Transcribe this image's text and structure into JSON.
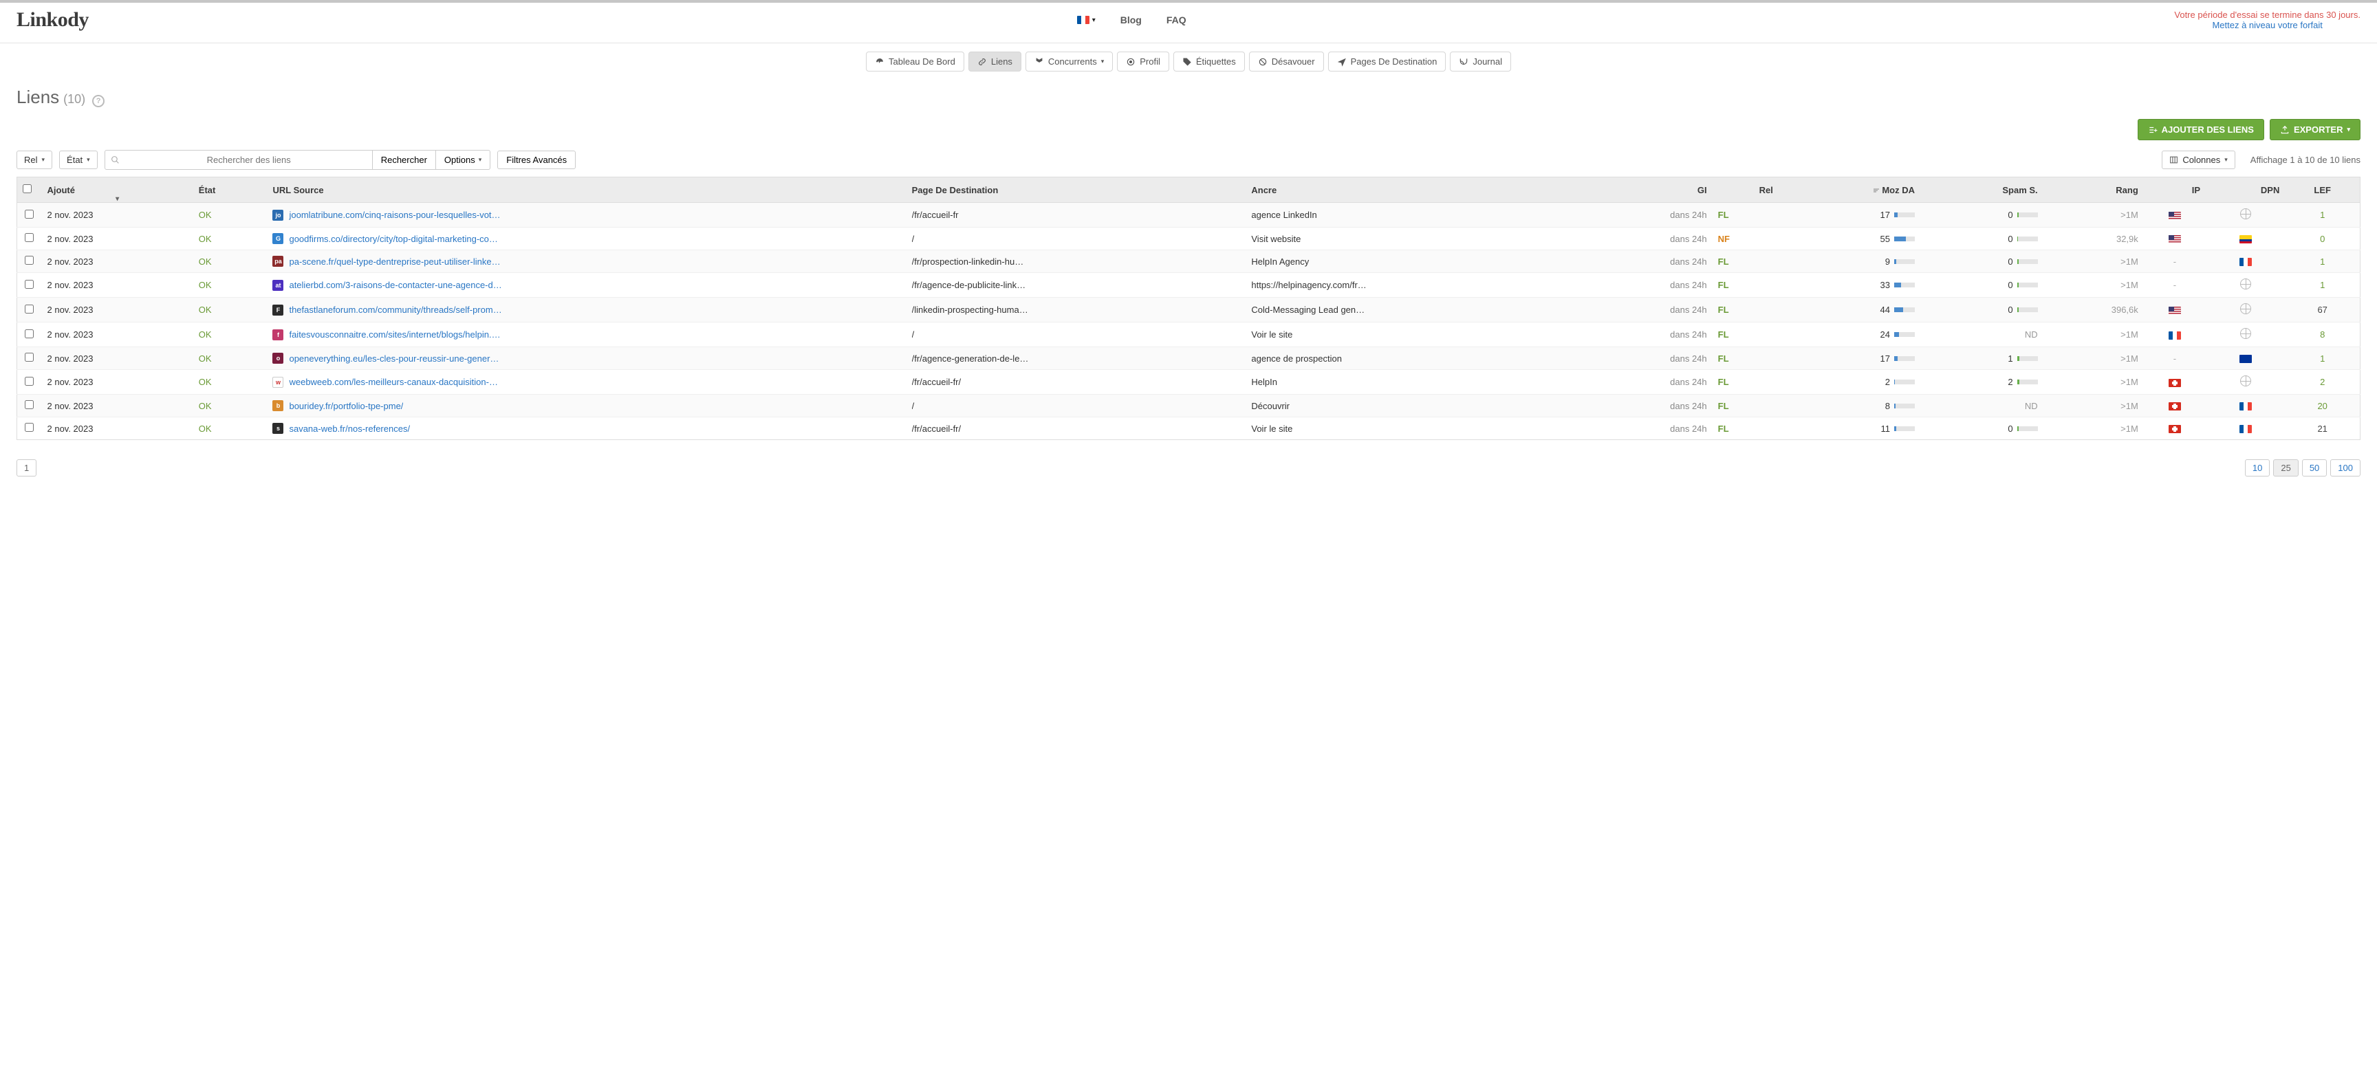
{
  "header": {
    "logo": "Linkody",
    "language_flag": "fr",
    "nav": {
      "blog": "Blog",
      "faq": "FAQ"
    },
    "trial_message": "Votre période d'essai se termine dans 30 jours.",
    "upgrade_link": "Mettez à niveau votre forfait"
  },
  "tabs": {
    "dashboard": "Tableau De Bord",
    "links": "Liens",
    "competitors": "Concurrents",
    "profile": "Profil",
    "tags": "Étiquettes",
    "disavow": "Désavouer",
    "landing_pages": "Pages De Destination",
    "journal": "Journal"
  },
  "page": {
    "title": "Liens",
    "count_label": "(10)"
  },
  "actions": {
    "add_links": "AJOUTER DES LIENS",
    "export": "EXPORTER"
  },
  "toolbar": {
    "rel_dd": "Rel",
    "state_dd": "État",
    "search_placeholder": "Rechercher des liens",
    "search_btn": "Rechercher",
    "options_btn": "Options",
    "adv_filters": "Filtres Avancés",
    "columns_btn": "Colonnes",
    "display_info": "Affichage 1 à 10 de 10 liens"
  },
  "columns": {
    "added": "Ajouté",
    "state": "État",
    "source_url": "URL Source",
    "dest_page": "Page De Destination",
    "anchor": "Ancre",
    "gi": "GI",
    "rel": "Rel",
    "moz_da": "Moz DA",
    "spam": "Spam S.",
    "rank": "Rang",
    "ip": "IP",
    "dpn": "DPN",
    "lef": "LEF"
  },
  "rows": [
    {
      "added": "2 nov. 2023",
      "state": "OK",
      "fav_bg": "#2b6cb0",
      "fav_txt": "jo",
      "src": "joomlatribune.com/cinq-raisons-pour-lesquelles-votre-ent…",
      "dest": "/fr/accueil-fr",
      "anchor": "agence LinkedIn",
      "gi": "dans 24h",
      "rel": "FL",
      "moz_da": 17,
      "da_pct": 17,
      "spam": 0,
      "spam_pct": 8,
      "rank": ">1M",
      "ip": "us",
      "dpn": "globe",
      "lef": "1",
      "lef_color": "g"
    },
    {
      "added": "2 nov. 2023",
      "state": "OK",
      "fav_bg": "#3182ce",
      "fav_txt": "G",
      "src": "goodfirms.co/directory/city/top-digital-marketing-compani…",
      "dest": "/",
      "anchor": "Visit website",
      "gi": "dans 24h",
      "rel": "NF",
      "moz_da": 55,
      "da_pct": 55,
      "spam": 0,
      "spam_pct": 6,
      "rank": "32,9k",
      "ip": "us",
      "dpn": "co",
      "lef": "0",
      "lef_color": "g"
    },
    {
      "added": "2 nov. 2023",
      "state": "OK",
      "fav_bg": "#8b2b2b",
      "fav_txt": "pa",
      "src": "pa-scene.fr/quel-type-dentreprise-peut-utiliser-linkedin-p…",
      "dest": "/fr/prospection-linkedin-hum…",
      "anchor": "HelpIn Agency",
      "gi": "dans 24h",
      "rel": "FL",
      "moz_da": 9,
      "da_pct": 9,
      "spam": 0,
      "spam_pct": 8,
      "rank": ">1M",
      "ip": "dash",
      "dpn": "fr",
      "lef": "1",
      "lef_color": "g"
    },
    {
      "added": "2 nov. 2023",
      "state": "OK",
      "fav_bg": "#4c2fbf",
      "fav_txt": "at",
      "src": "atelierbd.com/3-raisons-de-contacter-une-agence-de-pu…",
      "dest": "/fr/agence-de-publicite-linke…",
      "anchor": "https://helpinagency.com/fr/…",
      "gi": "dans 24h",
      "rel": "FL",
      "moz_da": 33,
      "da_pct": 33,
      "spam": 0,
      "spam_pct": 7,
      "rank": ">1M",
      "ip": "dash",
      "dpn": "globe",
      "lef": "1",
      "lef_color": "g"
    },
    {
      "added": "2 nov. 2023",
      "state": "OK",
      "fav_bg": "#2c2c2c",
      "fav_txt": "F",
      "src": "thefastlaneforum.com/community/threads/self-promotion…",
      "dest": "/linkedin-prospecting-huma…",
      "anchor": "Cold-Messaging Lead gene…",
      "gi": "dans 24h",
      "rel": "FL",
      "moz_da": 44,
      "da_pct": 44,
      "spam": 0,
      "spam_pct": 7,
      "rank": "396,6k",
      "ip": "us",
      "dpn": "globe",
      "lef": "67",
      "lef_color": "n"
    },
    {
      "added": "2 nov. 2023",
      "state": "OK",
      "fav_bg": "#c23a6b",
      "fav_txt": "f",
      "src": "faitesvousconnaitre.com/sites/internet/blogs/helpin.html",
      "dest": "/",
      "anchor": "Voir le site",
      "gi": "dans 24h",
      "rel": "FL",
      "moz_da": 24,
      "da_pct": 24,
      "spam": "ND",
      "spam_pct": 0,
      "rank": ">1M",
      "ip": "fr",
      "dpn": "globe",
      "lef": "8",
      "lef_color": "g"
    },
    {
      "added": "2 nov. 2023",
      "state": "OK",
      "fav_bg": "#7b1d3e",
      "fav_txt": "o",
      "src": "openeverything.eu/les-cles-pour-reussir-une-generation-…",
      "dest": "/fr/agence-generation-de-le…",
      "anchor": "agence de prospection",
      "gi": "dans 24h",
      "rel": "FL",
      "moz_da": 17,
      "da_pct": 17,
      "spam": 1,
      "spam_pct": 10,
      "rank": ">1M",
      "ip": "dash",
      "dpn": "eu",
      "lef": "1",
      "lef_color": "g"
    },
    {
      "added": "2 nov. 2023",
      "state": "OK",
      "fav_bg": "#ffffff",
      "fav_txt": "w",
      "src": "weebweeb.com/les-meilleurs-canaux-dacquisition-marke…",
      "dest": "/fr/accueil-fr/",
      "anchor": "HelpIn",
      "gi": "dans 24h",
      "rel": "FL",
      "moz_da": 2,
      "da_pct": 2,
      "spam": 2,
      "spam_pct": 12,
      "rank": ">1M",
      "ip": "ch",
      "dpn": "globe",
      "lef": "2",
      "lef_color": "g"
    },
    {
      "added": "2 nov. 2023",
      "state": "OK",
      "fav_bg": "#d98b2e",
      "fav_txt": "b",
      "src": "bouridey.fr/portfolio-tpe-pme/",
      "dest": "/",
      "anchor": "Découvrir",
      "gi": "dans 24h",
      "rel": "FL",
      "moz_da": 8,
      "da_pct": 8,
      "spam": "ND",
      "spam_pct": 0,
      "rank": ">1M",
      "ip": "ch",
      "dpn": "fr",
      "lef": "20",
      "lef_color": "g"
    },
    {
      "added": "2 nov. 2023",
      "state": "OK",
      "fav_bg": "#2b2b2b",
      "fav_txt": "s",
      "src": "savana-web.fr/nos-references/",
      "dest": "/fr/accueil-fr/",
      "anchor": "Voir le site",
      "gi": "dans 24h",
      "rel": "FL",
      "moz_da": 11,
      "da_pct": 11,
      "spam": 0,
      "spam_pct": 7,
      "rank": ">1M",
      "ip": "ch",
      "dpn": "fr",
      "lef": "21",
      "lef_color": "n"
    }
  ],
  "pagination": {
    "current": "1",
    "sizes": [
      "10",
      "25",
      "50",
      "100"
    ],
    "active_size": "25"
  }
}
